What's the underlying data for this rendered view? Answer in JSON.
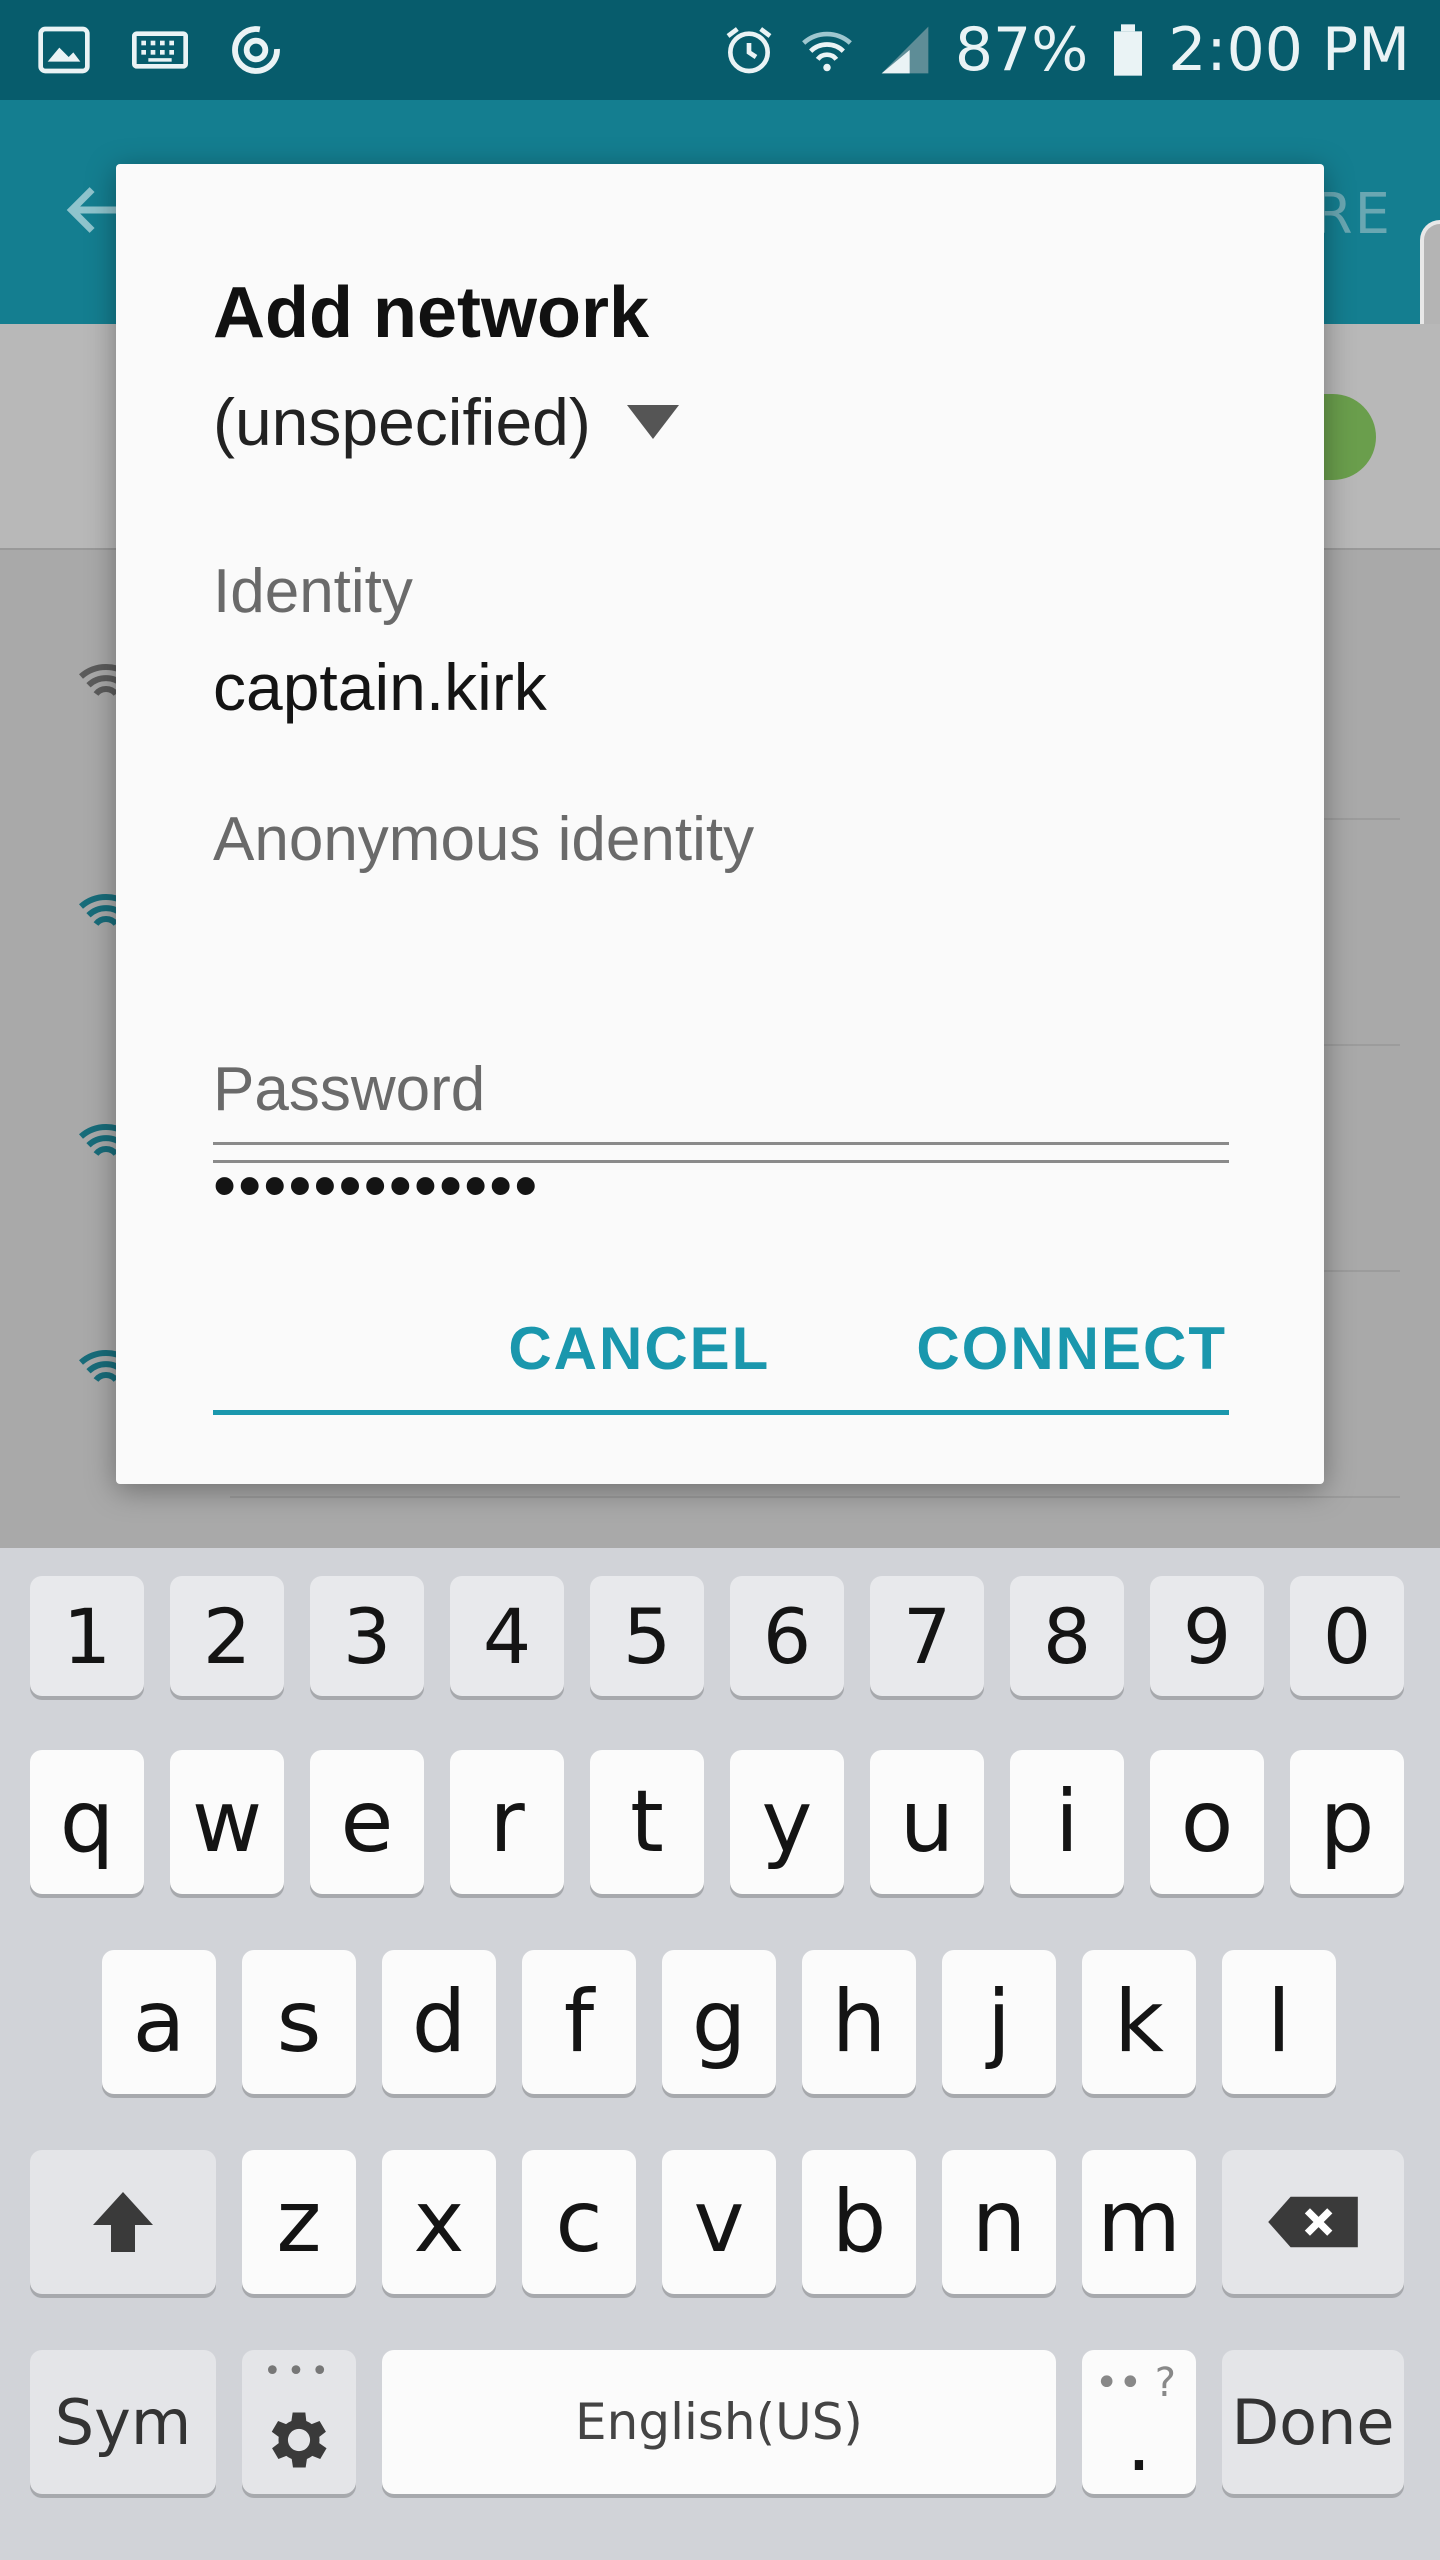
{
  "status_bar": {
    "battery": "87%",
    "time": "2:00 PM",
    "icons": [
      "gallery-icon",
      "keyboard-icon",
      "sync-icon",
      "alarm-icon",
      "wifi-icon",
      "signal-icon",
      "battery-icon"
    ]
  },
  "app_bar": {
    "back_icon": "arrow-left-icon",
    "action_partial": "RE"
  },
  "dialog": {
    "title": "Add network",
    "eap_method": "(unspecified)",
    "identity_label": "Identity",
    "identity_value": "captain.kirk",
    "anon_label": "Anonymous identity",
    "anon_value": "",
    "password_label": "Password",
    "password_value": "•••••••••••••",
    "cancel": "CANCEL",
    "connect": "CONNECT"
  },
  "keyboard": {
    "numbers": [
      "1",
      "2",
      "3",
      "4",
      "5",
      "6",
      "7",
      "8",
      "9",
      "0"
    ],
    "row1": [
      "q",
      "w",
      "e",
      "r",
      "t",
      "y",
      "u",
      "i",
      "o",
      "p"
    ],
    "row2": [
      "a",
      "s",
      "d",
      "f",
      "g",
      "h",
      "j",
      "k",
      "l"
    ],
    "row3": [
      "z",
      "x",
      "c",
      "v",
      "b",
      "n",
      "m"
    ],
    "sym": "Sym",
    "space": "English(US)",
    "period": ".",
    "period_hint": "•• ?",
    "settings_hint": "•••",
    "done": "Done"
  },
  "colors": {
    "status_bar": "#075c6c",
    "app_bar": "#147e90",
    "accent": "#1a97ad"
  }
}
